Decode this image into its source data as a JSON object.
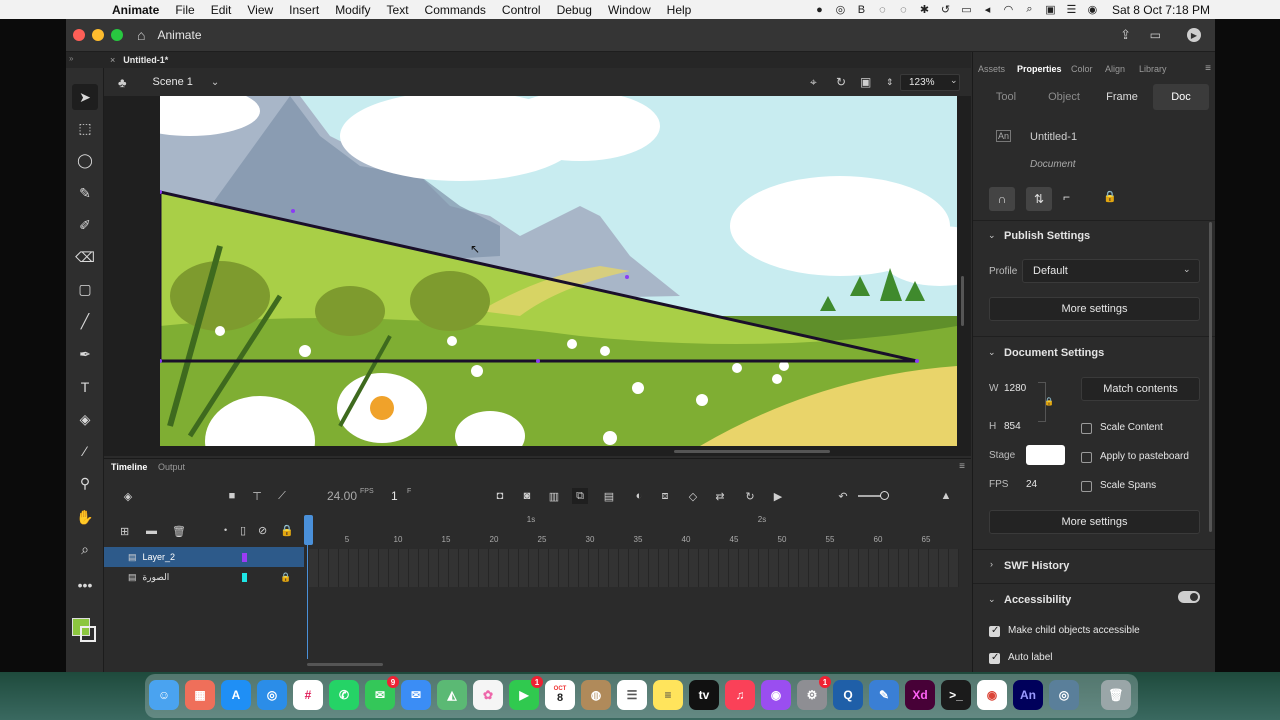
{
  "menubar": {
    "app": "Animate",
    "items": [
      "File",
      "Edit",
      "View",
      "Insert",
      "Modify",
      "Text",
      "Commands",
      "Control",
      "Debug",
      "Window",
      "Help"
    ],
    "clock": "Sat 8 Oct  7:18 PM"
  },
  "titlebar": {
    "app_title": "Animate"
  },
  "document": {
    "tab_name": "Untitled-1*",
    "scene": "Scene 1",
    "zoom": "123%"
  },
  "timeline": {
    "tabs": [
      "Timeline",
      "Output"
    ],
    "fps": "24.00",
    "fps_unit": "FPS",
    "frame": "1",
    "frame_unit": "F",
    "ruler_seconds": [
      "1s",
      "2s"
    ],
    "ruler_frames": [
      "5",
      "10",
      "15",
      "20",
      "25",
      "30",
      "35",
      "40",
      "45",
      "50",
      "55",
      "60",
      "65"
    ],
    "layers": [
      {
        "name": "Layer_2",
        "color": "#9b3cf5",
        "selected": true,
        "locked": false
      },
      {
        "name": "الصورة",
        "color": "#1ee6e6",
        "selected": false,
        "locked": true
      }
    ]
  },
  "panel": {
    "tabs": [
      "Assets",
      "Properties",
      "Color",
      "Align",
      "Library"
    ],
    "active_tab": "Properties",
    "subtabs": [
      "Tool",
      "Object",
      "Frame",
      "Doc"
    ],
    "active_subtab": "Doc",
    "doc_name": "Untitled-1",
    "doc_type": "Document",
    "publish": {
      "title": "Publish Settings",
      "profile_label": "Profile",
      "profile_value": "Default",
      "more": "More settings"
    },
    "docsettings": {
      "title": "Document Settings",
      "w_label": "W",
      "w_value": "1280",
      "h_label": "H",
      "h_value": "854",
      "match": "Match contents",
      "scale_content": "Scale Content",
      "apply_pasteboard": "Apply to pasteboard",
      "stage_label": "Stage",
      "stage_color": "#ffffff",
      "fps_label": "FPS",
      "fps_value": "24",
      "scale_spans": "Scale Spans",
      "more": "More settings"
    },
    "swf_history": "SWF History",
    "accessibility": {
      "title": "Accessibility",
      "make_child": "Make child objects accessible",
      "auto_label": "Auto label"
    }
  },
  "colors": {
    "fill": "#8cc63f",
    "stroke": "#000000",
    "accent_selection": "#2d5a8a"
  },
  "dock": {
    "icons": [
      "finder-icon",
      "launchpad-icon",
      "app-store-icon",
      "safari-icon",
      "slack-icon",
      "whatsapp-icon",
      "messages-icon",
      "mail-icon",
      "maps-icon",
      "photos-icon",
      "facetime-icon",
      "calendar-icon",
      "contacts-icon",
      "reminders-icon",
      "notes-icon",
      "appletv-icon",
      "music-icon",
      "podcasts-icon",
      "system-preferences-icon",
      "quicktime-icon",
      "sidecar-icon",
      "xd-icon",
      "terminal-icon",
      "chrome-icon",
      "animate-icon",
      "gyroflow-icon",
      "trash-icon"
    ],
    "badges": {
      "messages": "9",
      "facetime": "1",
      "system": "1"
    },
    "calendar_month": "OCT",
    "calendar_day": "8",
    "xd_label": "Xd",
    "an_label": "An",
    "tv_label": "tv"
  }
}
